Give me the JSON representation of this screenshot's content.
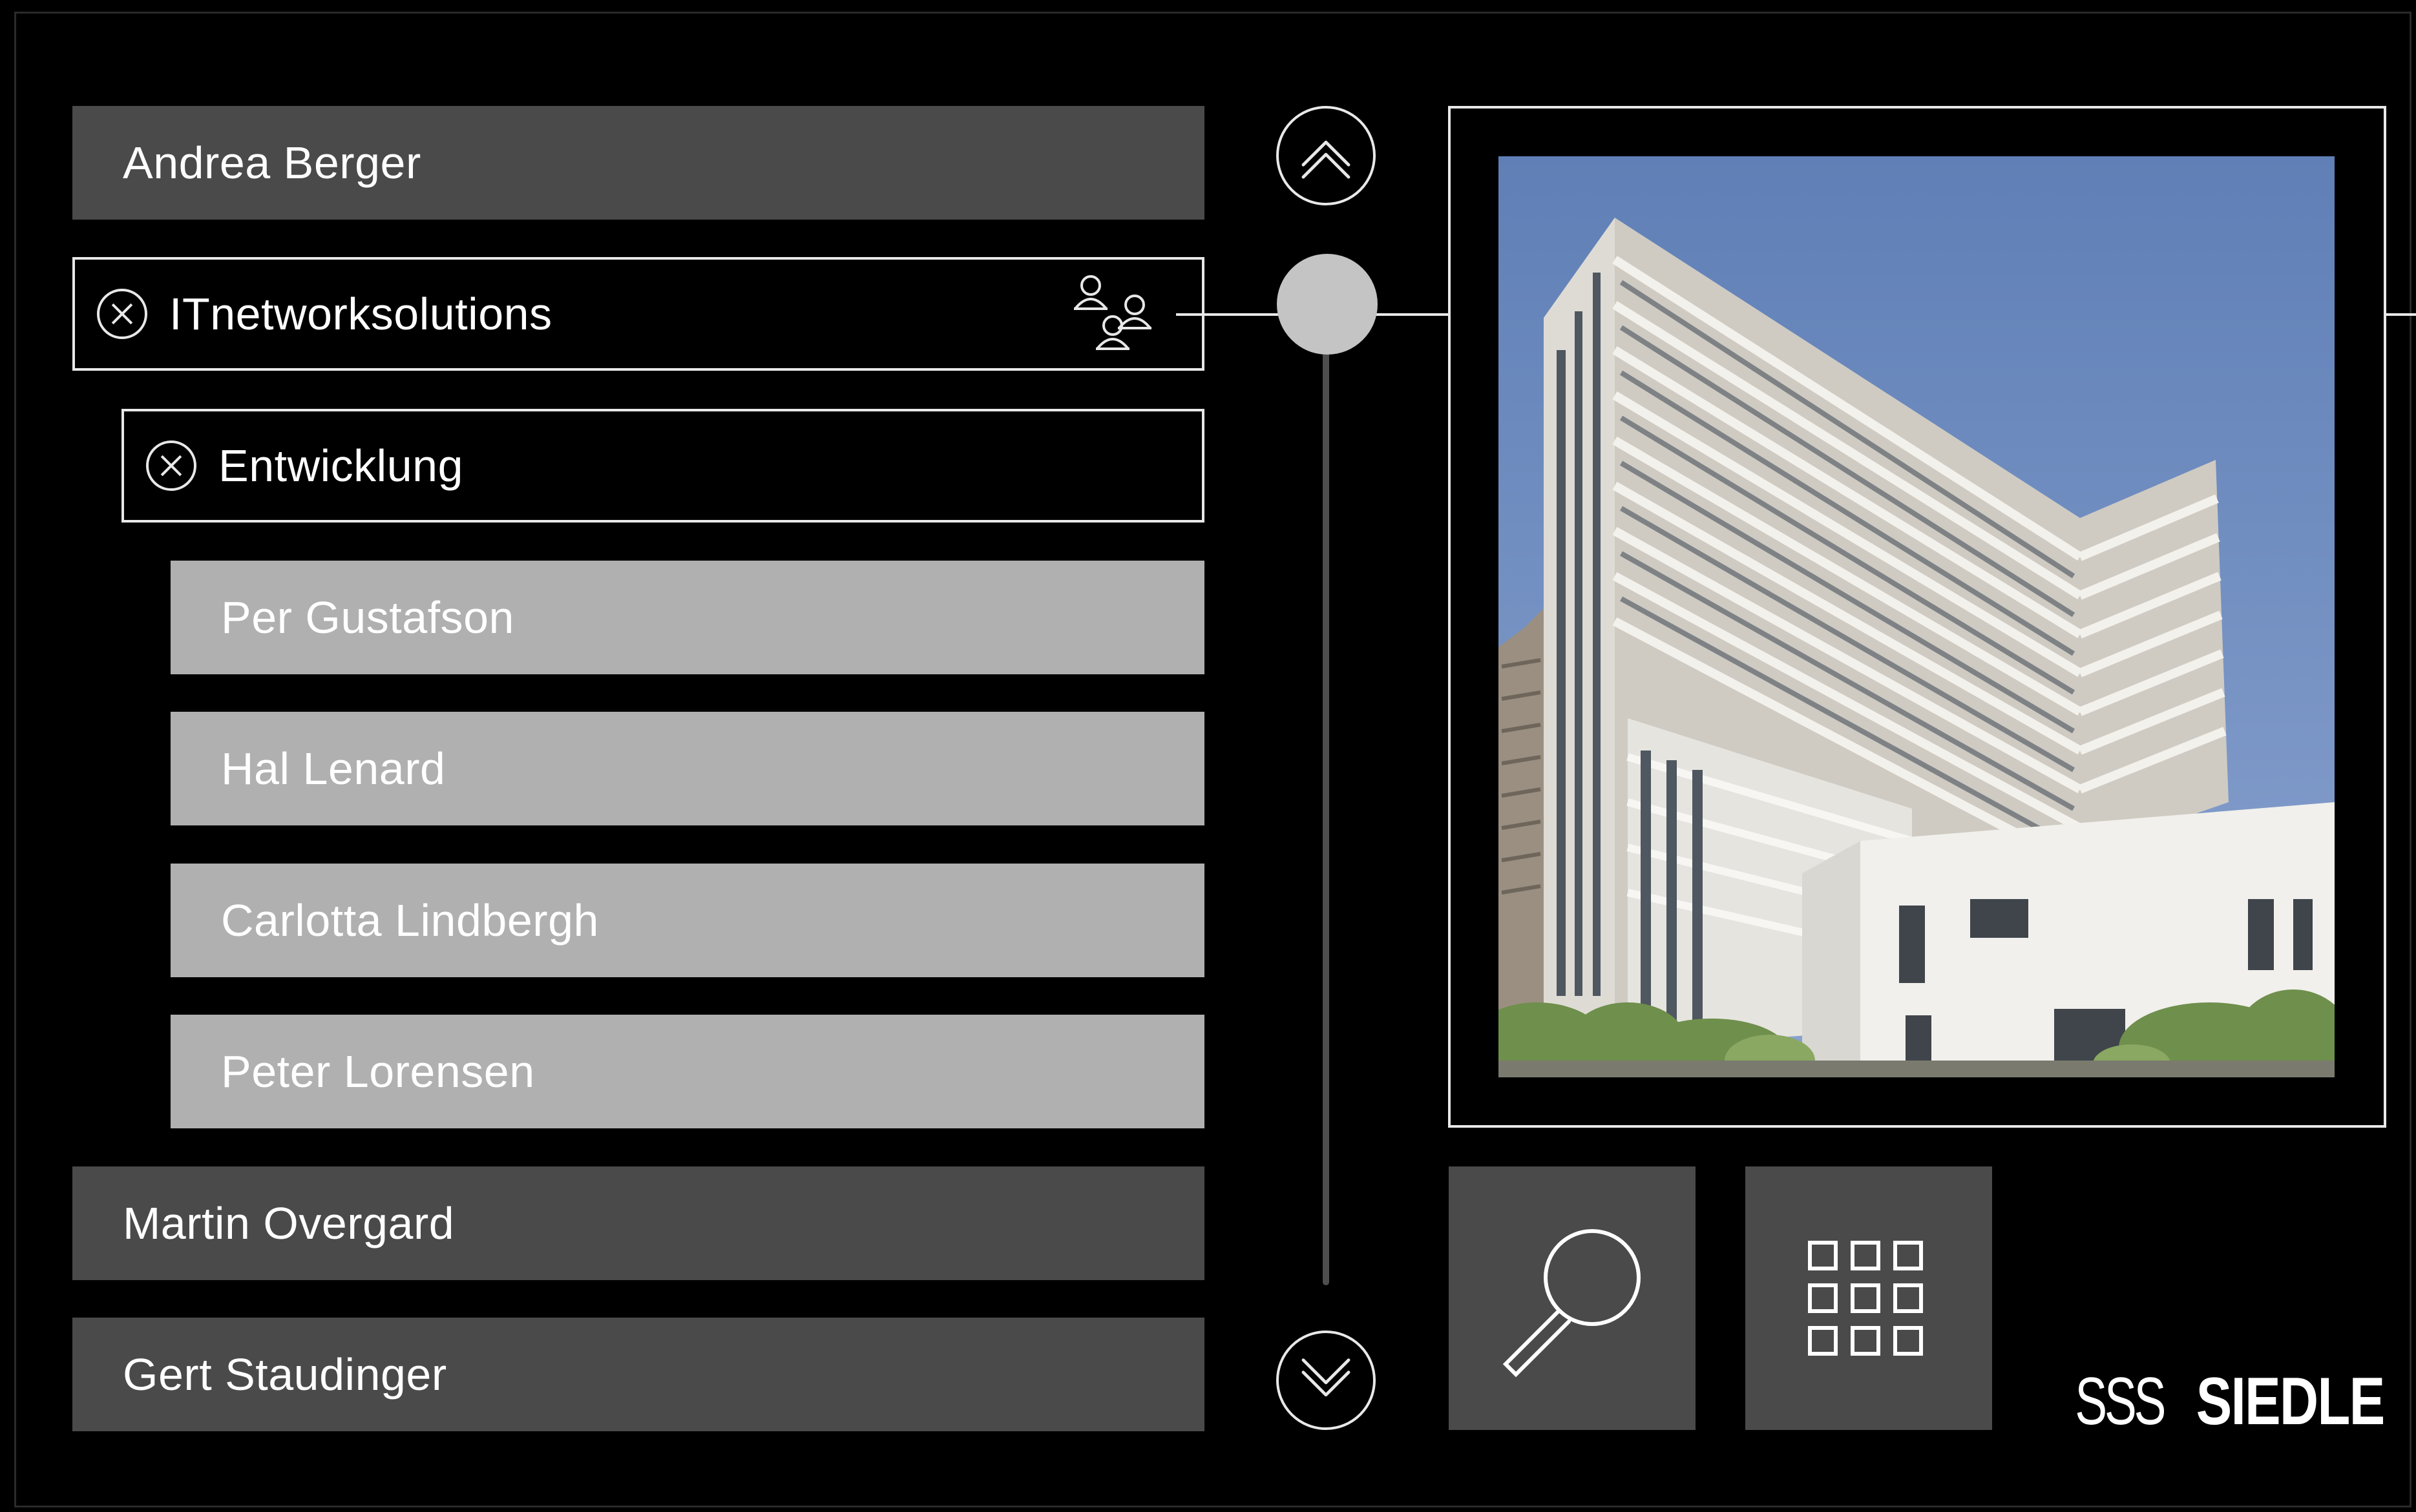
{
  "list": {
    "rows": [
      {
        "label": "Andrea Berger"
      },
      {
        "label": "ITnetworksolutions"
      },
      {
        "label": "Entwicklung"
      },
      {
        "label": "Per Gustafson"
      },
      {
        "label": "Hal Lenard"
      },
      {
        "label": "Carlotta Lindbergh"
      },
      {
        "label": "Peter Lorensen"
      },
      {
        "label": "Martin Overgard"
      },
      {
        "label": "Gert Staudinger"
      }
    ]
  },
  "icons": {
    "scroll_up": "double-chevron-up-icon",
    "scroll_down": "double-chevron-down-icon",
    "group": "group-icon",
    "close": "close-circle-icon",
    "search": "magnifier-icon",
    "keypad": "keypad-grid-icon"
  },
  "branding": {
    "logo_mark": "SSS",
    "logo_word": "SIEDLE"
  },
  "colors": {
    "background": "#000000",
    "row_dark": "#4a4a4a",
    "row_light": "#b0b0b0",
    "outline": "#e8e8e8",
    "scroll_thumb": "#c4c4c4"
  }
}
